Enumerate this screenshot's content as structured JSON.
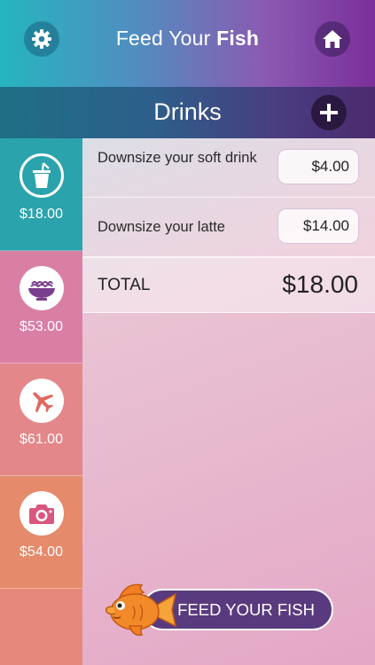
{
  "header": {
    "title_light": "Feed Your ",
    "title_bold": "Fish",
    "settings_icon": "gear-icon",
    "home_icon": "home-icon"
  },
  "category": {
    "title": "Drinks",
    "add_icon": "plus-icon"
  },
  "sidebar": {
    "items": [
      {
        "icon": "cup-icon",
        "amount": "$18.00",
        "active": true,
        "color": "#2ba3ac"
      },
      {
        "icon": "noodle-bowl-icon",
        "amount": "$53.00",
        "active": false,
        "color": "#d97fa4"
      },
      {
        "icon": "airplane-icon",
        "amount": "$61.00",
        "active": false,
        "color": "#e4878a"
      },
      {
        "icon": "camera-icon",
        "amount": "$54.00",
        "active": false,
        "color": "#e58a6a"
      }
    ]
  },
  "items": [
    {
      "label": "Downsize your soft drink",
      "price": "$4.00"
    },
    {
      "label": "Downsize your latte",
      "price": "$14.00"
    }
  ],
  "total": {
    "label": "TOTAL",
    "value": "$18.00"
  },
  "feed_button": {
    "label": "FEED YOUR FISH"
  },
  "colors": {
    "accent_teal": "#2ba3ac",
    "accent_purple": "#5a3a7e",
    "fish_orange": "#f28a2a"
  }
}
